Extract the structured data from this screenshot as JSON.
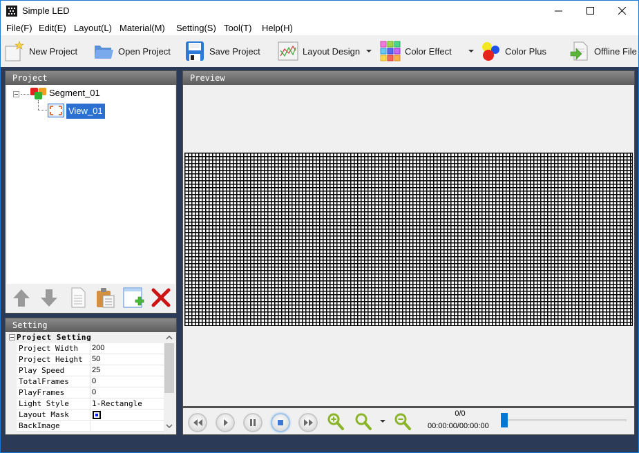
{
  "window": {
    "title": "Simple LED",
    "controls": [
      "minimize",
      "maximize",
      "close"
    ]
  },
  "menu": [
    {
      "label": "File(F)"
    },
    {
      "label": "Edit(E)"
    },
    {
      "label": "Layout(L)"
    },
    {
      "label": "Material(M)"
    },
    {
      "label": "Setting(S)"
    },
    {
      "label": "Tool(T)"
    },
    {
      "label": "Help(H)"
    }
  ],
  "toolbar": {
    "new_project": "New Project",
    "open_project": "Open Project",
    "save_project": "Save Project",
    "layout_design": "Layout Design",
    "color_effect": "Color Effect",
    "color_plus": "Color Plus",
    "offline_file": "Offline File"
  },
  "project_panel": {
    "title": "Project",
    "tree": {
      "segment": "Segment_01",
      "view": "View_01",
      "selected": "View_01"
    },
    "tools": [
      "move-up",
      "move-down",
      "copy",
      "paste",
      "add-view",
      "delete"
    ]
  },
  "setting_panel": {
    "title": "Setting",
    "category": "Project Setting",
    "properties": [
      {
        "key": "Project Width",
        "value": "200"
      },
      {
        "key": "Project Height",
        "value": "50"
      },
      {
        "key": "Play Speed",
        "value": "25"
      },
      {
        "key": "TotalFrames",
        "value": "0"
      },
      {
        "key": "PlayFrames",
        "value": "0"
      },
      {
        "key": "Light Style",
        "value": "1-Rectangle"
      },
      {
        "key": "Layout Mask",
        "value": ""
      },
      {
        "key": "BackImage",
        "value": ""
      }
    ],
    "layout_mask_color": "#0018ff"
  },
  "preview_panel": {
    "title": "Preview",
    "grid": {
      "columns": 200,
      "rows": 50
    }
  },
  "player": {
    "frame_counter": "0/0",
    "time_counter": "00:00:00/00:00:00",
    "progress": 0,
    "controls": [
      "rewind",
      "play",
      "pause",
      "stop",
      "fast-forward",
      "zoom-in",
      "zoom-fit",
      "zoom-out"
    ]
  },
  "colors": {
    "accent": "#0078d7",
    "selection": "#2b6fd1",
    "frame_bg": "#2b3a56",
    "panel_header": "#6e6e6e"
  }
}
